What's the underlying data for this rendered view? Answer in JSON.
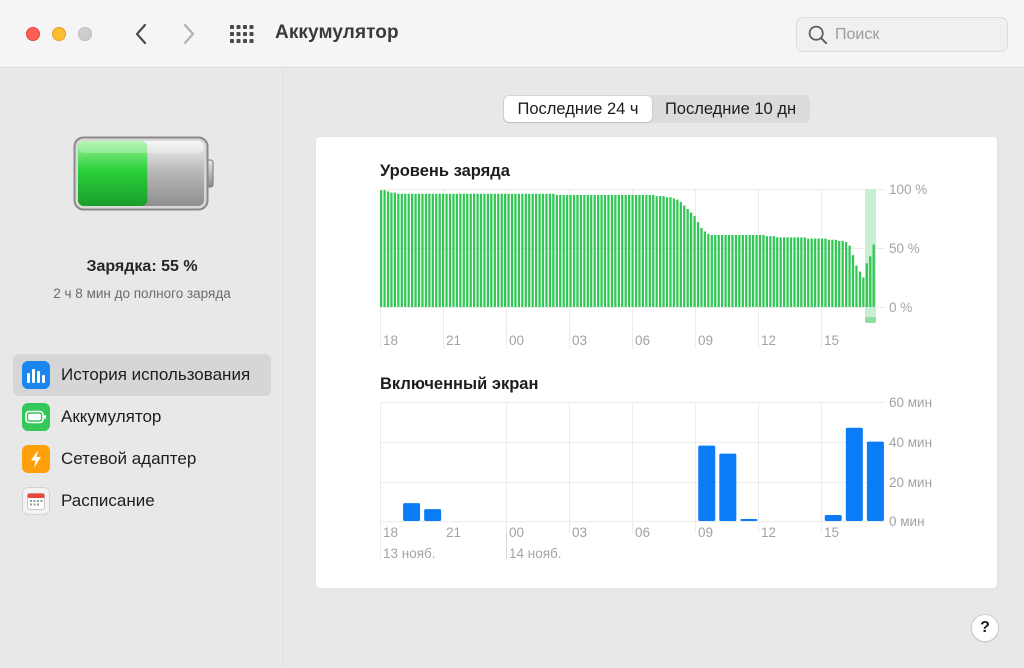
{
  "window": {
    "title": "Аккумулятор"
  },
  "search": {
    "placeholder": "Поиск"
  },
  "sidebar": {
    "charge_title": "Зарядка: 55 %",
    "charge_subtitle": "2 ч 8 мин до полного заряда",
    "battery_level": 0.55,
    "items": [
      {
        "label": "История использования",
        "icon": "usage-history-icon",
        "color": "#1a86f0",
        "active": true
      },
      {
        "label": "Аккумулятор",
        "icon": "battery-icon",
        "color": "#34c759",
        "active": false
      },
      {
        "label": "Сетевой адаптер",
        "icon": "power-adapter-icon",
        "color": "#ff9f0a",
        "active": false
      },
      {
        "label": "Расписание",
        "icon": "calendar-icon",
        "color": "#e8e8e8",
        "active": false
      }
    ]
  },
  "tabs": [
    {
      "label": "Последние 24 ч",
      "active": true
    },
    {
      "label": "Последние 10 дн",
      "active": false
    }
  ],
  "help": {
    "label": "?"
  },
  "colors": {
    "battery_bar": "#31c754",
    "battery_charging": "#c8efd1",
    "screen_bar": "#0a7cf5"
  },
  "chart_data": [
    {
      "type": "bar",
      "title": "Уровень заряда",
      "x_tick_labels": [
        "18",
        "21",
        "00",
        "03",
        "06",
        "09",
        "12",
        "15"
      ],
      "y_tick_labels": [
        "100 %",
        "50 %",
        "0 %"
      ],
      "ylim": [
        0,
        100
      ],
      "grid": true,
      "values": [
        99,
        99,
        98,
        97,
        97,
        96,
        96,
        96,
        96,
        96,
        96,
        96,
        96,
        96,
        96,
        96,
        96,
        96,
        96,
        96,
        96,
        96,
        96,
        96,
        96,
        96,
        96,
        96,
        96,
        96,
        96,
        96,
        96,
        96,
        96,
        96,
        96,
        96,
        96,
        96,
        96,
        96,
        96,
        96,
        96,
        96,
        96,
        96,
        96,
        96,
        96,
        95,
        95,
        95,
        95,
        95,
        95,
        95,
        95,
        95,
        95,
        95,
        95,
        95,
        95,
        95,
        95,
        95,
        95,
        95,
        95,
        95,
        95,
        95,
        95,
        95,
        95,
        95,
        95,
        95,
        94,
        94,
        94,
        93,
        93,
        92,
        91,
        89,
        86,
        83,
        80,
        77,
        72,
        67,
        64,
        62,
        61,
        61,
        61,
        61,
        61,
        61,
        61,
        61,
        61,
        61,
        61,
        61,
        61,
        61,
        61,
        61,
        60,
        60,
        60,
        59,
        59,
        59,
        59,
        59,
        59,
        59,
        59,
        59,
        58,
        58,
        58,
        58,
        58,
        58,
        57,
        57,
        57,
        56,
        56,
        55,
        52,
        44,
        35,
        30,
        25,
        37,
        43,
        53
      ]
    },
    {
      "type": "bar",
      "title": "Включенный экран",
      "x_tick_labels": [
        "18",
        "21",
        "00",
        "03",
        "06",
        "09",
        "12",
        "15"
      ],
      "date_labels": [
        {
          "label": "13 нояб.",
          "at": "18"
        },
        {
          "label": "14 нояб.",
          "at": "00"
        }
      ],
      "y_tick_labels": [
        "60 мин",
        "40 мин",
        "20 мин",
        "0 мин"
      ],
      "ylim": [
        0,
        60
      ],
      "grid": true,
      "values": [
        0,
        9,
        6,
        0,
        0,
        0,
        0,
        0,
        0,
        0,
        0,
        0,
        0,
        0,
        0,
        38,
        34,
        1,
        0,
        0,
        0,
        3,
        47,
        40
      ]
    }
  ]
}
